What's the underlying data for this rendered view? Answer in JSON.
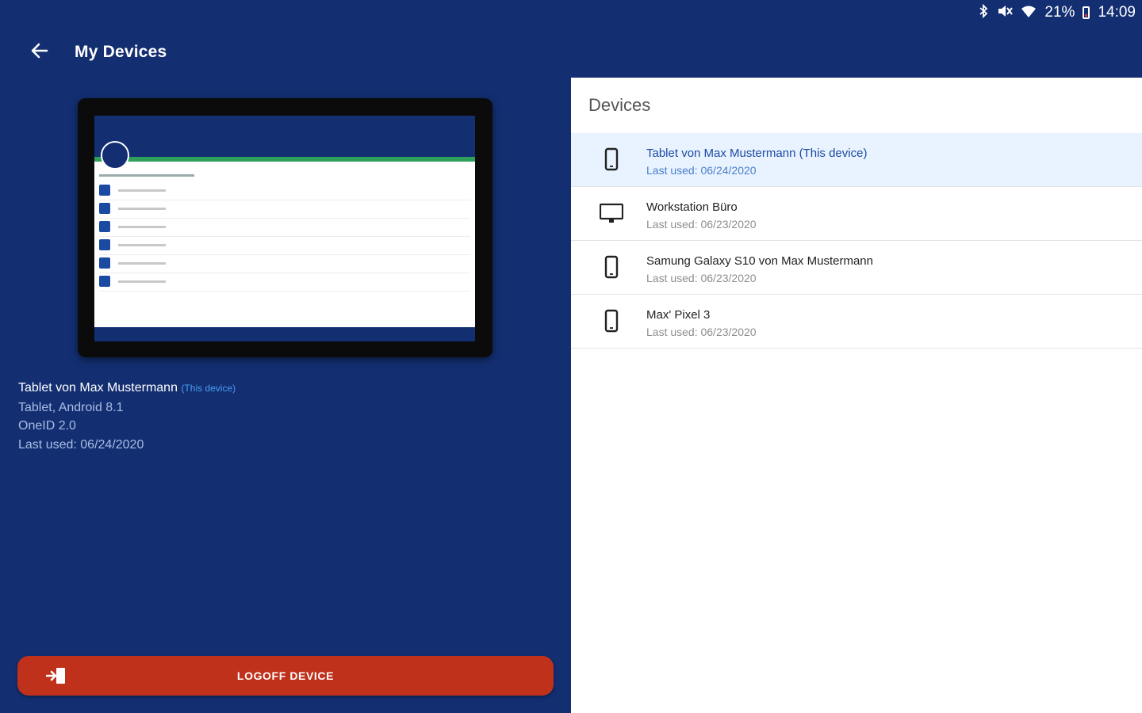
{
  "status_bar": {
    "battery": "21%",
    "time": "14:09"
  },
  "app_bar": {
    "title": "My Devices"
  },
  "device_info": {
    "name": "Tablet von Max Mustermann",
    "tag": "(This device)",
    "type": "Tablet, Android 8.1",
    "app_version": "OneID 2.0",
    "last_used": "Last used: 06/24/2020"
  },
  "logoff": {
    "label": "LOGOFF DEVICE"
  },
  "devices_panel": {
    "title": "Devices",
    "items": [
      {
        "name": "Tablet von Max Mustermann (This device)",
        "last_used": "Last used: 06/24/2020",
        "icon": "phone-icon",
        "selected": true
      },
      {
        "name": "Workstation Büro",
        "last_used": "Last used: 06/23/2020",
        "icon": "monitor-icon",
        "selected": false
      },
      {
        "name": "Samung Galaxy S10 von Max Mustermann",
        "last_used": "Last used: 06/23/2020",
        "icon": "phone-icon",
        "selected": false
      },
      {
        "name": "Max' Pixel 3",
        "last_used": "Last used: 06/23/2020",
        "icon": "phone-icon",
        "selected": false
      }
    ]
  },
  "colors": {
    "background": "#132f72",
    "accent": "#1b4aa3",
    "logoff": "#c0311b",
    "selected_row": "#e9f3ff"
  }
}
